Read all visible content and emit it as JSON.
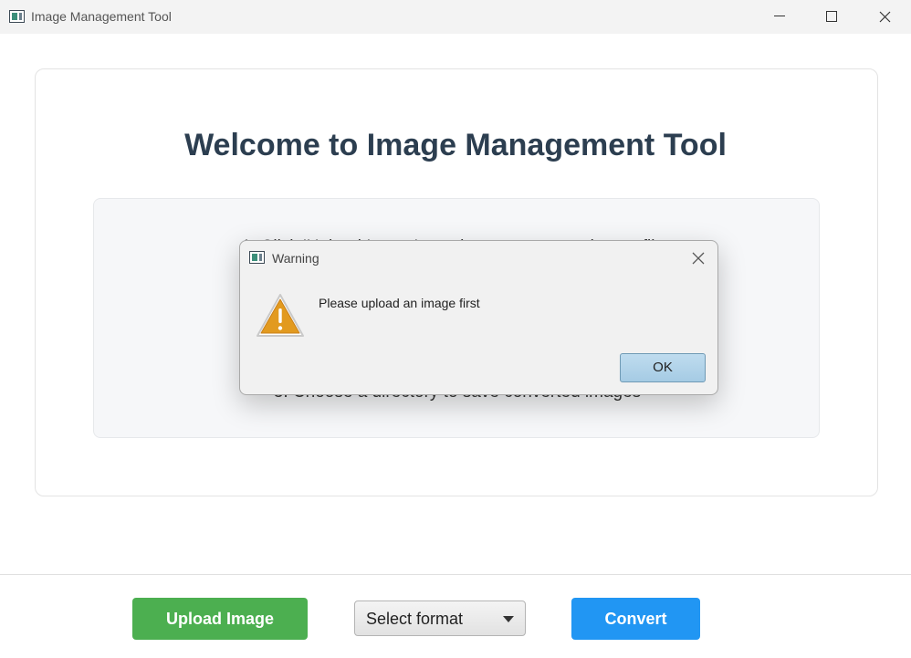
{
  "window": {
    "title": "Image Management Tool"
  },
  "main": {
    "heading": "Welcome to Image Management Tool",
    "instructions": [
      "1. Click 'Upload Image' to select one or more image files",
      "3. Choose a directory to save converted images"
    ]
  },
  "toolbar": {
    "upload_label": "Upload Image",
    "format_select_value": "Select format",
    "convert_label": "Convert"
  },
  "dialog": {
    "title": "Warning",
    "message": "Please upload an image first",
    "ok_label": "OK",
    "icon": "warning-icon"
  },
  "colors": {
    "upload_button": "#4caf50",
    "convert_button": "#2196f3",
    "heading": "#2c3e50",
    "warning": "#e29a1f"
  }
}
